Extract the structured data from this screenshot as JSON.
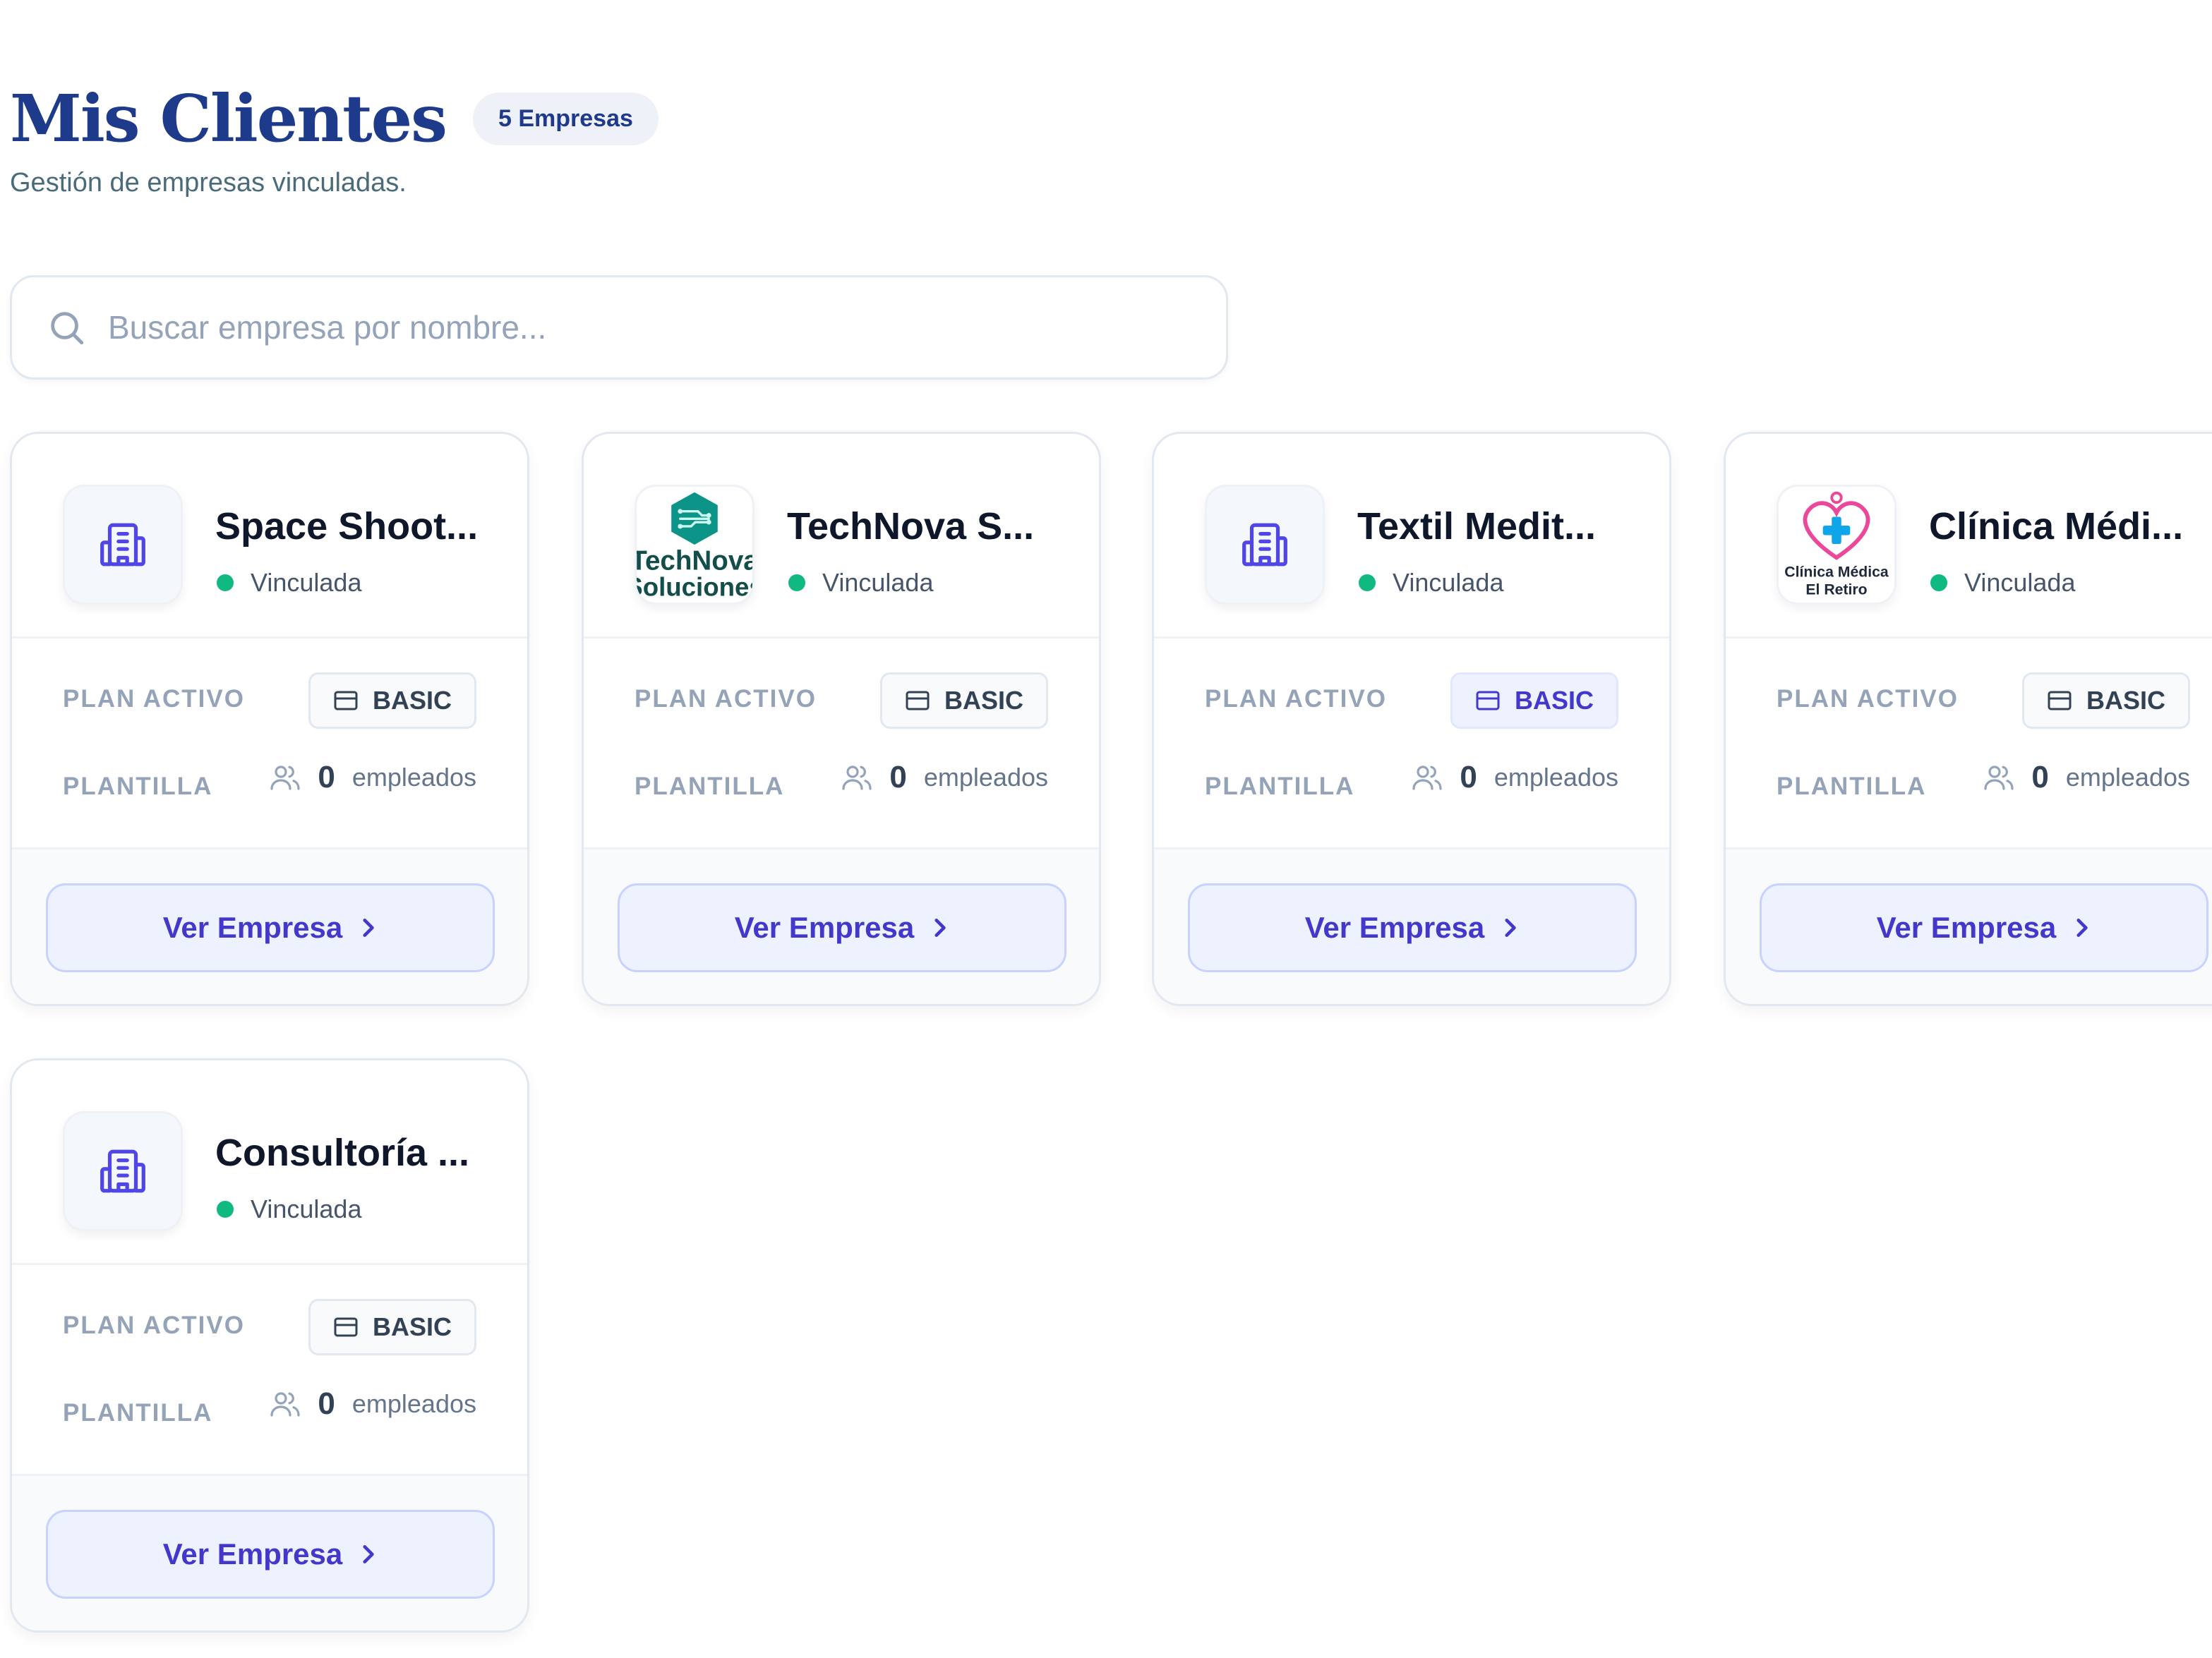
{
  "header": {
    "title": "Mis Clientes",
    "count_badge": "5 Empresas",
    "subtitle": "Gestión de empresas vinculadas."
  },
  "search": {
    "placeholder": "Buscar empresa por nombre...",
    "value": "",
    "icon": "search-icon"
  },
  "labels": {
    "plan": "PLAN ACTIVO",
    "staff": "PLANTILLA",
    "staff_unit": "empleados",
    "view_button": "Ver Empresa"
  },
  "companies": [
    {
      "name": "Space Shoot...",
      "status": "Vinculada",
      "plan": "BASIC",
      "employees": "0",
      "logo": "building-icon"
    },
    {
      "name": "TechNova S...",
      "status": "Vinculada",
      "plan": "BASIC",
      "employees": "0",
      "logo": "technova-logo",
      "logo_text": [
        "TechNova",
        "Soluciones"
      ]
    },
    {
      "name": "Textil Medit...",
      "status": "Vinculada",
      "plan": "BASIC",
      "employees": "0",
      "logo": "building-icon"
    },
    {
      "name": "Clínica Médi...",
      "status": "Vinculada",
      "plan": "BASIC",
      "employees": "0",
      "logo": "clinica-logo",
      "logo_text": [
        "Clínica Médica",
        "El Retiro"
      ]
    },
    {
      "name": "Consultoría ...",
      "status": "Vinculada",
      "plan": "BASIC",
      "employees": "0",
      "logo": "building-icon"
    }
  ],
  "colors": {
    "title": "#1e3a8a",
    "accent": "#4338ca",
    "status_linked": "#10b981",
    "technova": "#0d9488",
    "clinica_heart": "#ec4899",
    "clinica_cross": "#0ea5e9"
  }
}
